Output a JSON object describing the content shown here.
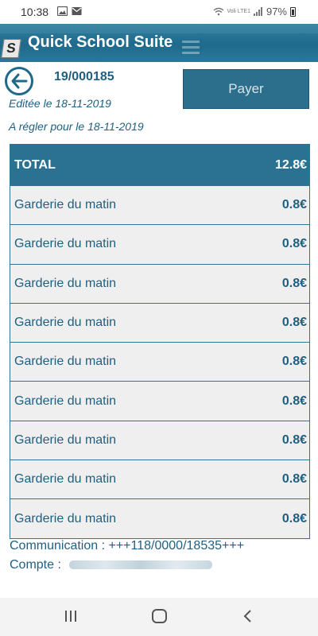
{
  "status_bar": {
    "time": "10:38",
    "network": "Voli LTE1",
    "battery": "97%"
  },
  "app": {
    "title": "Quick School Suite",
    "logo_letter": "S"
  },
  "invoice": {
    "number": "19/000185",
    "pay_label": "Payer",
    "edited": "Editée le 18-11-2019",
    "due": "A régler pour le 18-11-2019"
  },
  "table": {
    "total_label": "TOTAL",
    "total_value": "12.8€",
    "items": [
      {
        "label": "Garderie du matin",
        "value": "0.8€"
      },
      {
        "label": "Garderie du matin",
        "value": "0.8€"
      },
      {
        "label": "Garderie du matin",
        "value": "0.8€"
      },
      {
        "label": "Garderie du matin",
        "value": "0.8€"
      },
      {
        "label": "Garderie du matin",
        "value": "0.8€"
      },
      {
        "label": "Garderie du matin",
        "value": "0.8€"
      },
      {
        "label": "Garderie du matin",
        "value": "0.8€"
      },
      {
        "label": "Garderie du matin",
        "value": "0.8€"
      },
      {
        "label": "Garderie du matin",
        "value": "0.8€"
      }
    ]
  },
  "footer": {
    "communication": "Communication : +++118/0000/18535+++",
    "account_label": "Compte :"
  },
  "colors": {
    "primary": "#2b7292",
    "text": "#1f5f80",
    "row_bg": "#efefef"
  },
  "icons": [
    "image-icon",
    "mail-icon",
    "wifi-icon",
    "signal-icon",
    "battery-icon",
    "back-arrow-icon",
    "menu-icon",
    "recents-icon",
    "home-icon",
    "nav-back-icon"
  ]
}
